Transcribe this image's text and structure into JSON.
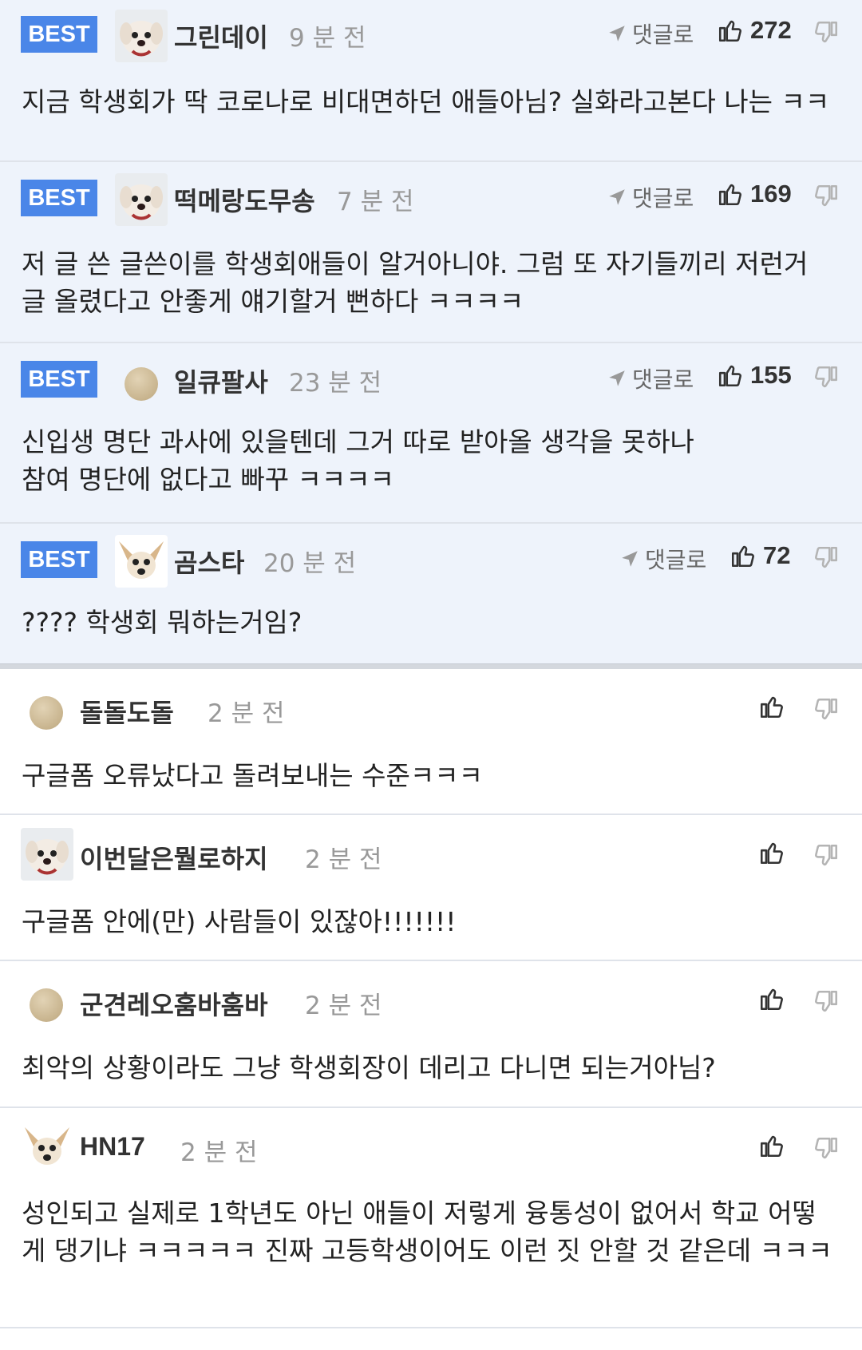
{
  "best_label": "BEST",
  "reply_label": "댓글로",
  "best_comments": [
    {
      "nick": "그린데이",
      "time": "9 분 전",
      "likes": "272",
      "text": "지금 학생회가 딱 코로나로 비대면하던 애들아님? 실화라고본다 나는 ㅋㅋ"
    },
    {
      "nick": "떡메랑도무송",
      "time": "7 분 전",
      "likes": "169",
      "text": "저 글 쓴 글쓴이를 학생회애들이 알거아니야. 그럼 또 자기들끼리 저런거 글 올렸다고 안좋게 얘기할거 뻔하다 ㅋㅋㅋㅋ"
    },
    {
      "nick": "일큐팔사",
      "time": "23 분 전",
      "likes": "155",
      "text": "신입생 명단 과사에 있을텐데 그거 따로 받아올 생각을 못하나\n참여 명단에 없다고 빠꾸 ㅋㅋㅋㅋ"
    },
    {
      "nick": "곰스타",
      "time": "20 분 전",
      "likes": "72",
      "text": "???? 학생회 뭐하는거임?"
    }
  ],
  "comments": [
    {
      "nick": "돌돌도돌",
      "time": "2 분 전",
      "text": "구글폼 오류났다고 돌려보내는 수준ㅋㅋㅋ"
    },
    {
      "nick": "이번달은뭘로하지",
      "time": "2 분 전",
      "text": "구글폼 안에(만) 사람들이 있잖아!!!!!!!"
    },
    {
      "nick": "군견레오훔바훔바",
      "time": "2 분 전",
      "text": "최악의 상황이라도 그냥 학생회장이 데리고 다니면 되는거아님?"
    },
    {
      "nick": "HN17",
      "time": "2 분 전",
      "text": "성인되고 실제로 1학년도 아닌 애들이 저렇게 융통성이 없어서 학교 어떻게 댕기냐 ㅋㅋㅋㅋㅋ 진짜 고등학생이어도 이런 짓 안할 것 같은데 ㅋㅋㅋ"
    }
  ],
  "icons": {
    "reply": "send-arrow-icon",
    "like": "thumbs-up-icon",
    "dislike": "thumbs-down-icon"
  },
  "colors": {
    "best_badge": "#4a86e8",
    "best_bg": "#eef3fb"
  }
}
